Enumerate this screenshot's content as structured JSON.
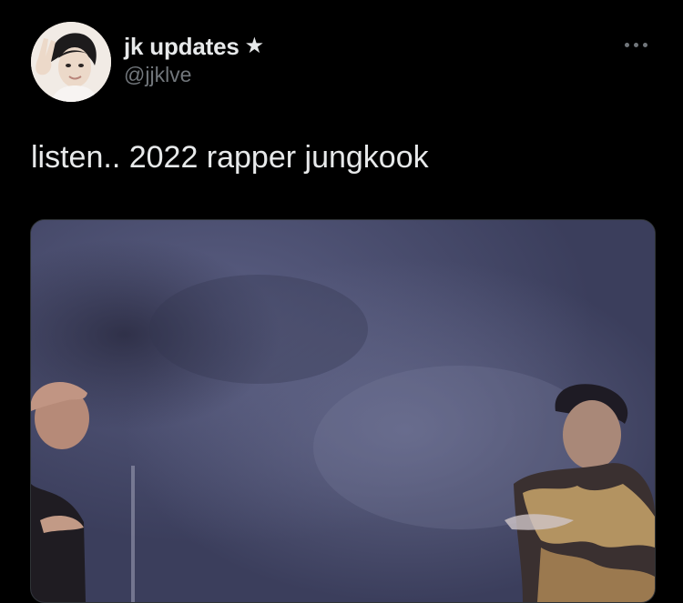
{
  "tweet": {
    "display_name": "jk updates",
    "badge_icon": "star-icon",
    "badge_glyph": "★",
    "handle": "@jjklve",
    "text": "listen.. 2022 rapper jungkook",
    "more_icon": "more-horizontal-icon",
    "media_type": "video-still"
  },
  "colors": {
    "background": "#000000",
    "primary_text": "#e7e9ea",
    "secondary_text": "#71767b",
    "media_stage": "#4a4d6e"
  }
}
